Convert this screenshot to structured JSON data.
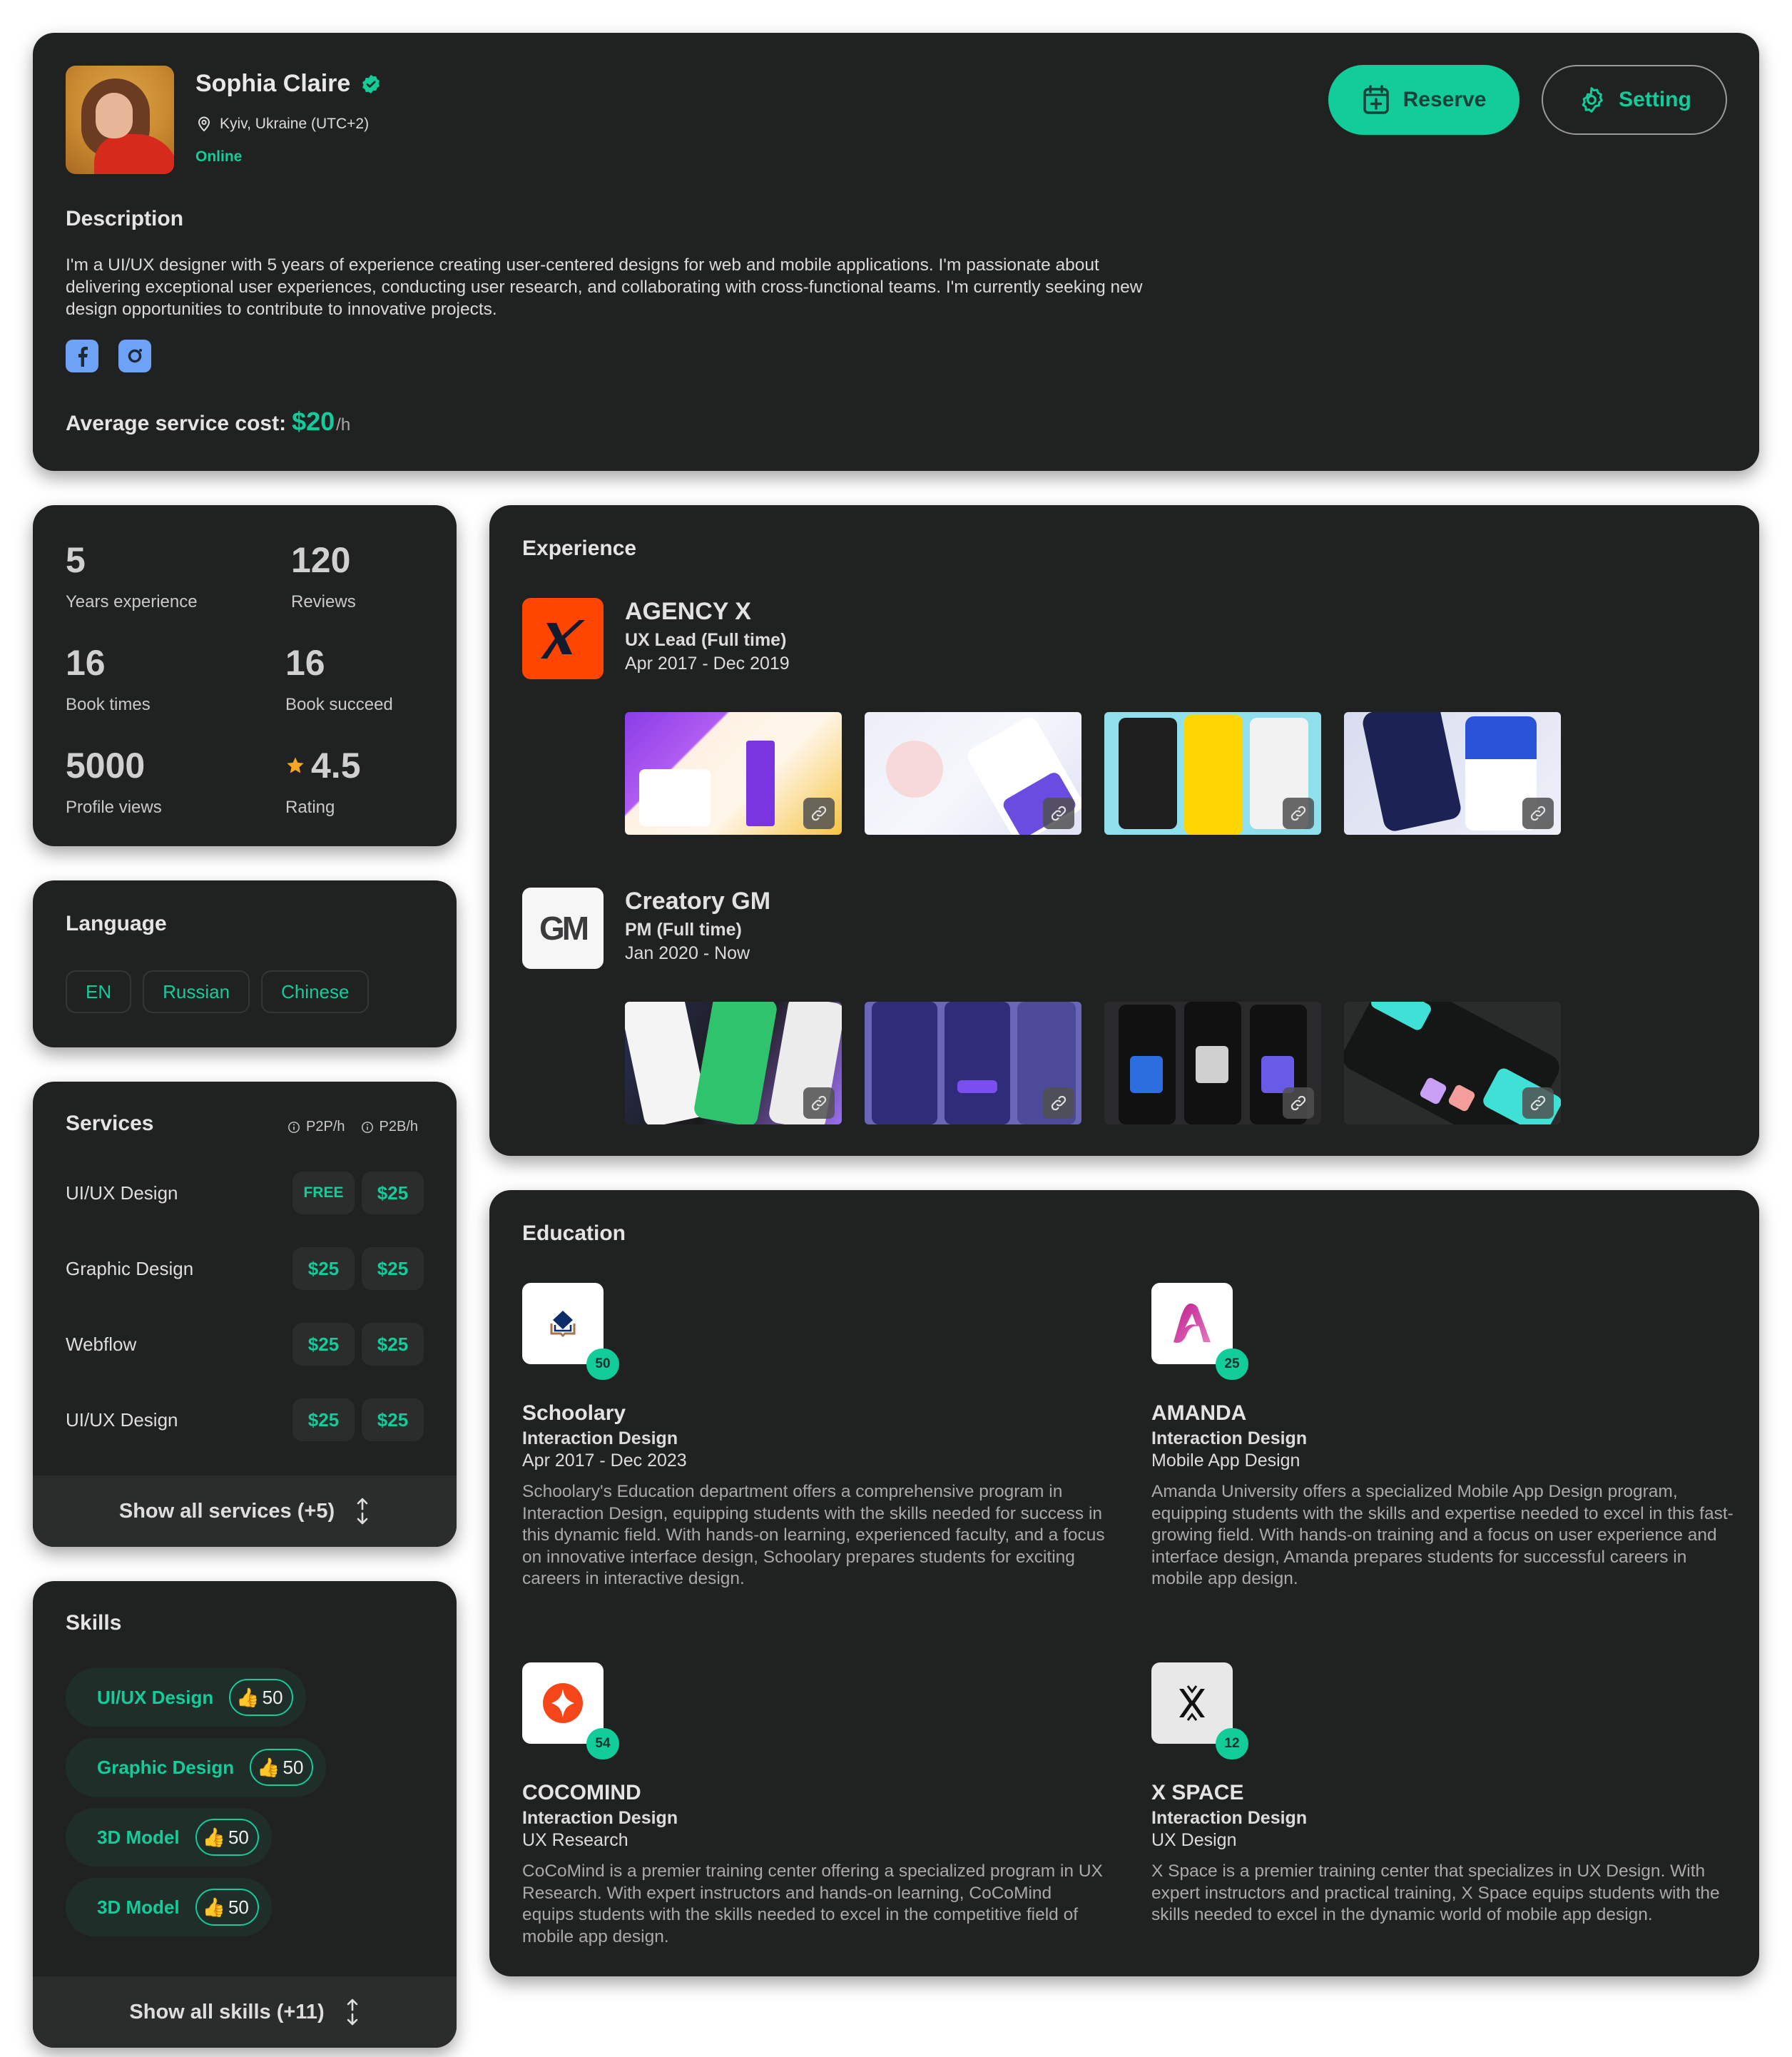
{
  "profile": {
    "name": "Sophia Claire",
    "location": "Kyiv, Ukraine (UTC+2)",
    "status": "Online",
    "reserve_label": "Reserve",
    "setting_label": "Setting",
    "description_title": "Description",
    "description": "I'm a UI/UX designer with 5 years of experience creating user-centered designs for web and mobile applications. I'm passionate about delivering exceptional user experiences, conducting user research, and collaborating with cross-functional teams. I'm currently seeking new design opportunities to contribute to innovative projects.",
    "socials": [
      "facebook",
      "instagram"
    ],
    "cost_label": "Average service cost:",
    "cost_value": "$20",
    "cost_unit": "/h"
  },
  "stats": [
    {
      "value": "5",
      "label": "Years experience"
    },
    {
      "value": "120",
      "label": "Reviews"
    },
    {
      "value": "16",
      "label": "Book times"
    },
    {
      "value": "16",
      "label": "Book succeed"
    },
    {
      "value": "5000",
      "label": "Profile views"
    },
    {
      "value": "4.5",
      "label": "Rating",
      "icon": "star-icon"
    }
  ],
  "language": {
    "title": "Language",
    "items": [
      "EN",
      "Russian",
      "Chinese"
    ]
  },
  "services": {
    "title": "Services",
    "col1": "P2P/h",
    "col2": "P2B/h",
    "rows": [
      {
        "name": "UI/UX Design",
        "p2p": "FREE",
        "p2b": "$25"
      },
      {
        "name": "Graphic Design",
        "p2p": "$25",
        "p2b": "$25"
      },
      {
        "name": "Webflow",
        "p2p": "$25",
        "p2b": "$25"
      },
      {
        "name": "UI/UX Design",
        "p2p": "$25",
        "p2b": "$25"
      }
    ],
    "show_all": "Show all services (+5)"
  },
  "skills": {
    "title": "Skills",
    "items": [
      {
        "name": "UI/UX Design",
        "votes": "50"
      },
      {
        "name": "Graphic Design",
        "votes": "50"
      },
      {
        "name": "3D Model",
        "votes": "50"
      },
      {
        "name": "3D Model",
        "votes": "50"
      }
    ],
    "show_all": "Show all skills (+11)"
  },
  "experience": {
    "title": "Experience",
    "items": [
      {
        "company": "AGENCY X",
        "role": "UX Lead (Full time)",
        "dates": "Apr 2017 - Dec 2019",
        "logo_text": "X"
      },
      {
        "company": "Creatory GM",
        "role": "PM (Full time)",
        "dates": "Jan 2020 - Now",
        "logo_text": "GM"
      }
    ]
  },
  "education": {
    "title": "Education",
    "items": [
      {
        "name": "Schoolary",
        "program": "Interaction Design",
        "sub": "Apr 2017 - Dec 2023",
        "badge": "50",
        "description": "Schoolary's Education department offers a comprehensive program in Interaction Design, equipping students with the skills needed for success in this dynamic field. With hands-on learning, experienced faculty, and a focus on innovative interface design, Schoolary prepares students for exciting careers in interactive design."
      },
      {
        "name": "AMANDA",
        "program": "Interaction Design",
        "sub": "Mobile App Design",
        "badge": "25",
        "description": "Amanda University offers a specialized Mobile App Design program, equipping students with the skills and expertise needed to excel in this fast-growing field. With hands-on training and a focus on user experience and interface design, Amanda prepares students for successful careers in mobile app design."
      },
      {
        "name": "COCOMIND",
        "program": "Interaction Design",
        "sub": "UX Research",
        "badge": "54",
        "description": "CoCoMind is a premier training center offering a specialized program in UX Research. With expert instructors and hands-on learning, CoCoMind equips students with the skills needed to excel in the competitive field of mobile app design."
      },
      {
        "name": "X SPACE",
        "program": "Interaction Design",
        "sub": "UX Design",
        "badge": "12",
        "description": "X Space is a premier training center that specializes in UX Design. With expert instructors and practical training, X Space equips students with the skills needed to excel in the dynamic world of mobile app design."
      }
    ]
  },
  "colors": {
    "accent": "#12cc9a",
    "card_bg": "#202221",
    "social": "#6ea2f6",
    "agency_x": "#ff4500",
    "star": "#f5a623"
  }
}
